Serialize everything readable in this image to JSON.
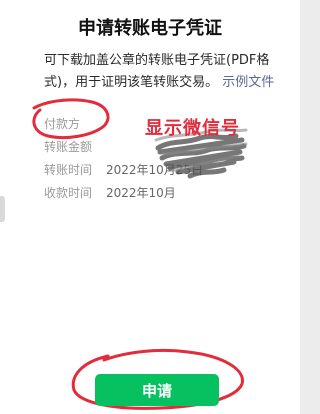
{
  "dialog": {
    "title": "申请转账电子凭证",
    "description": "可下载加盖公章的转账电子凭证(PDF格式)，用于证明该笔转账交易。",
    "example_link": "示例文件"
  },
  "details": [
    {
      "label": "付款方",
      "value": ""
    },
    {
      "label": "转账金额",
      "value": ""
    },
    {
      "label": "转账时间",
      "value": "2022年10月25日"
    },
    {
      "label": "收款时间",
      "value": "2022年10月"
    }
  ],
  "annotation": {
    "text": "显示微信号",
    "color": "#e32b3c"
  },
  "actions": {
    "apply_label": "申请"
  },
  "colors": {
    "primary": "#07c160",
    "link": "#576b95",
    "annotation": "#e32b3c"
  }
}
